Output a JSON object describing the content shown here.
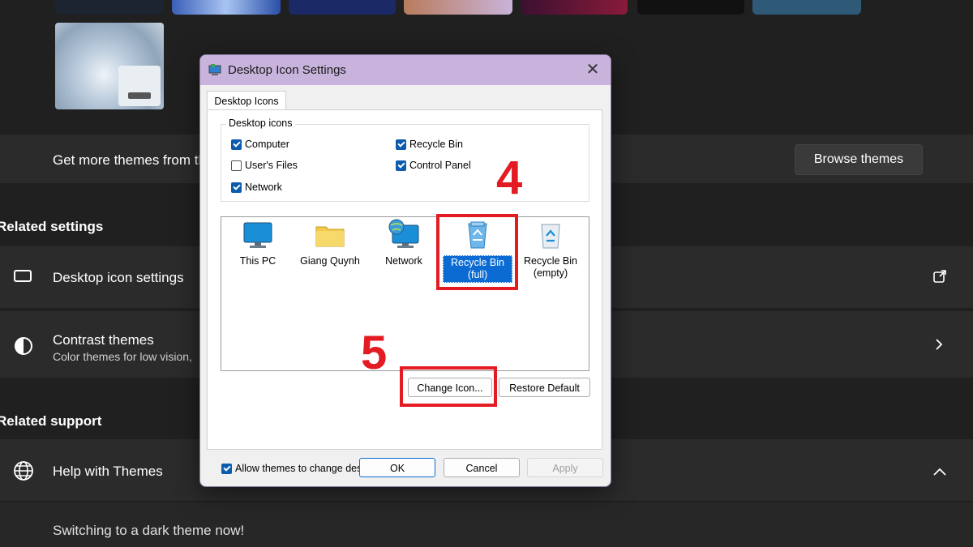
{
  "settings": {
    "get_more_themes": "Get more themes from th",
    "browse_themes": "Browse themes",
    "related_settings": "Related settings",
    "desktop_icon_settings": "Desktop icon settings",
    "contrast_themes": "Contrast themes",
    "contrast_sub": "Color themes for low vision,",
    "related_support": "Related support",
    "help_with_themes": "Help with Themes",
    "switching": "Switching to a dark theme now!"
  },
  "dialog": {
    "title": "Desktop Icon Settings",
    "tab": "Desktop Icons",
    "group_label": "Desktop icons",
    "checkboxes": [
      {
        "label": "Computer",
        "checked": true
      },
      {
        "label": "Recycle Bin",
        "checked": true
      },
      {
        "label": "User's Files",
        "checked": false
      },
      {
        "label": "Control Panel",
        "checked": true
      },
      {
        "label": "Network",
        "checked": true
      }
    ],
    "icons": [
      {
        "label": "This PC",
        "icon": "monitor-icon"
      },
      {
        "label": "Giang Quynh",
        "icon": "folder-icon"
      },
      {
        "label": "Network",
        "icon": "network-icon"
      },
      {
        "label": "Recycle Bin (full)",
        "icon": "recycle-bin-full-icon",
        "selected": true
      },
      {
        "label": "Recycle Bin (empty)",
        "icon": "recycle-bin-empty-icon"
      }
    ],
    "change_icon": "Change Icon...",
    "restore_default": "Restore Default",
    "allow_themes": "Allow themes to change desktop icons",
    "ok": "OK",
    "cancel": "Cancel",
    "apply": "Apply"
  },
  "annotations": {
    "step4": "4",
    "step5": "5"
  },
  "colors": {
    "annotation_red": "#e31b23",
    "titlebar": "#c8b3dd",
    "checkbox_blue": "#0b5cad",
    "selection_blue": "#0b6bd3"
  }
}
